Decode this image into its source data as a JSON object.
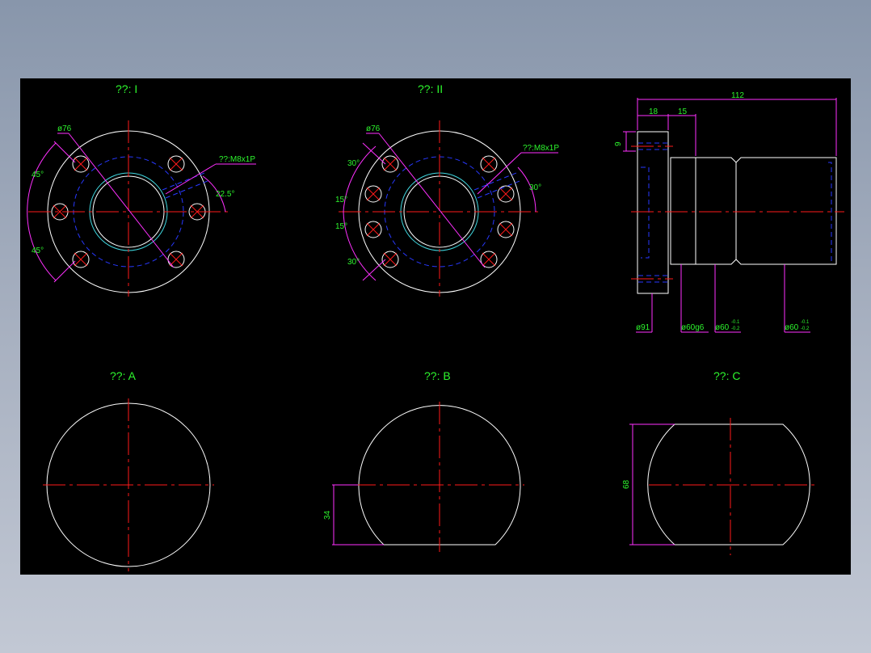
{
  "views": {
    "view_1": {
      "title": "??: I"
    },
    "view_2": {
      "title": "??: II"
    },
    "view_a": {
      "title": "??: A"
    },
    "view_b": {
      "title": "??: B"
    },
    "view_c": {
      "title": "??: C"
    }
  },
  "dims": {
    "v1_diameter": "ø76",
    "v1_thread": "??:M8x1P",
    "v1_angle_top": "45°",
    "v1_angle_bottom": "45°",
    "v1_angle_right": "22.5°",
    "v2_diameter": "ø76",
    "v2_thread": "??:M8x1P",
    "v2_angle_top": "30°",
    "v2_angle_mid_top": "15°",
    "v2_angle_mid_bottom": "15°",
    "v2_angle_bottom": "30°",
    "v2_angle_right": "30°",
    "side_total": "112",
    "side_flange": "18",
    "side_step": "15",
    "side_height": "9",
    "side_d91": "ø91",
    "side_d60g6": "ø60g6",
    "side_d60_a": "ø60",
    "side_d60_b": "ø60",
    "side_tol_upper": "-0.1",
    "side_tol_lower": "-0.2",
    "vb_dim": "34",
    "vc_dim": "68"
  },
  "colors": {
    "background": "#000000",
    "outline": "#ffffff",
    "centerline": "#ff1a1a",
    "hidden": "#2838ff",
    "dimension": "#ff30ff",
    "text": "#2df52d"
  }
}
